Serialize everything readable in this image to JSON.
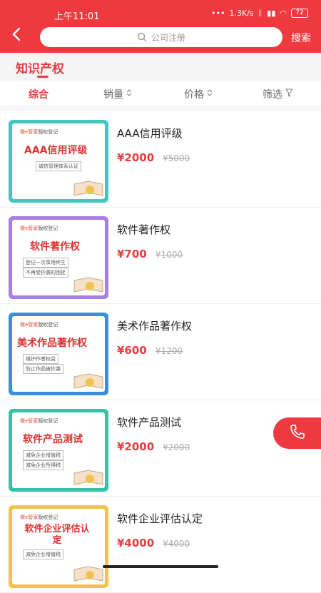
{
  "status_bar": {
    "time": "上午11:01",
    "net_speed": "1.3K/s",
    "battery": "72"
  },
  "header": {
    "search_placeholder": "公司注册",
    "search_button": "搜索"
  },
  "category": {
    "title": "知识产权"
  },
  "sort_bar": [
    {
      "label": "综合"
    },
    {
      "label": "销量"
    },
    {
      "label": "价格"
    },
    {
      "label": "筛选"
    }
  ],
  "products": [
    {
      "name": "AAA信用评级",
      "price": "¥2000",
      "original_price": "¥5000",
      "thumb": {
        "brand": "微e管家",
        "tag": "版权登记",
        "title": "AAA信用评级",
        "lines": [
          "诚信管理体系认证"
        ],
        "frame_color": "#3fc7c0"
      }
    },
    {
      "name": "软件著作权",
      "price": "¥700",
      "original_price": "¥1000",
      "thumb": {
        "brand": "微e管家",
        "tag": "版权登记",
        "title": "软件著作权",
        "lines": [
          "登记一次享用终生",
          "不再受抄袭的困扰"
        ],
        "frame_color": "#a57ee6"
      }
    },
    {
      "name": "美术作品著作权",
      "price": "¥600",
      "original_price": "¥1200",
      "thumb": {
        "brand": "微e管家",
        "tag": "版权登记",
        "title": "美术作品著作权",
        "lines": [
          "维护作者权益",
          "防止作品被抄袭"
        ],
        "frame_color": "#3b8fe0"
      }
    },
    {
      "name": "软件产品测试",
      "price": "¥2000",
      "original_price": "¥2000",
      "thumb": {
        "brand": "微e管家",
        "tag": "版权登记",
        "title": "软件产品测试",
        "lines": [
          "减免企业增值税",
          "减免企业所得税"
        ],
        "frame_color": "#34c2a8"
      }
    },
    {
      "name": "软件企业评估认定",
      "price": "¥4000",
      "original_price": "¥4000",
      "thumb": {
        "brand": "微e管家",
        "tag": "版权登记",
        "title": "软件企业评估认定",
        "lines": [
          "减免企业增值税"
        ],
        "frame_color": "#f2c34a"
      }
    }
  ],
  "colors": {
    "brand_red": "#ee3a3f",
    "price_red": "#e43e43"
  },
  "icons": {
    "back": "chevron-left-icon",
    "search": "search-icon",
    "filter": "filter-icon",
    "phone": "phone-icon"
  }
}
